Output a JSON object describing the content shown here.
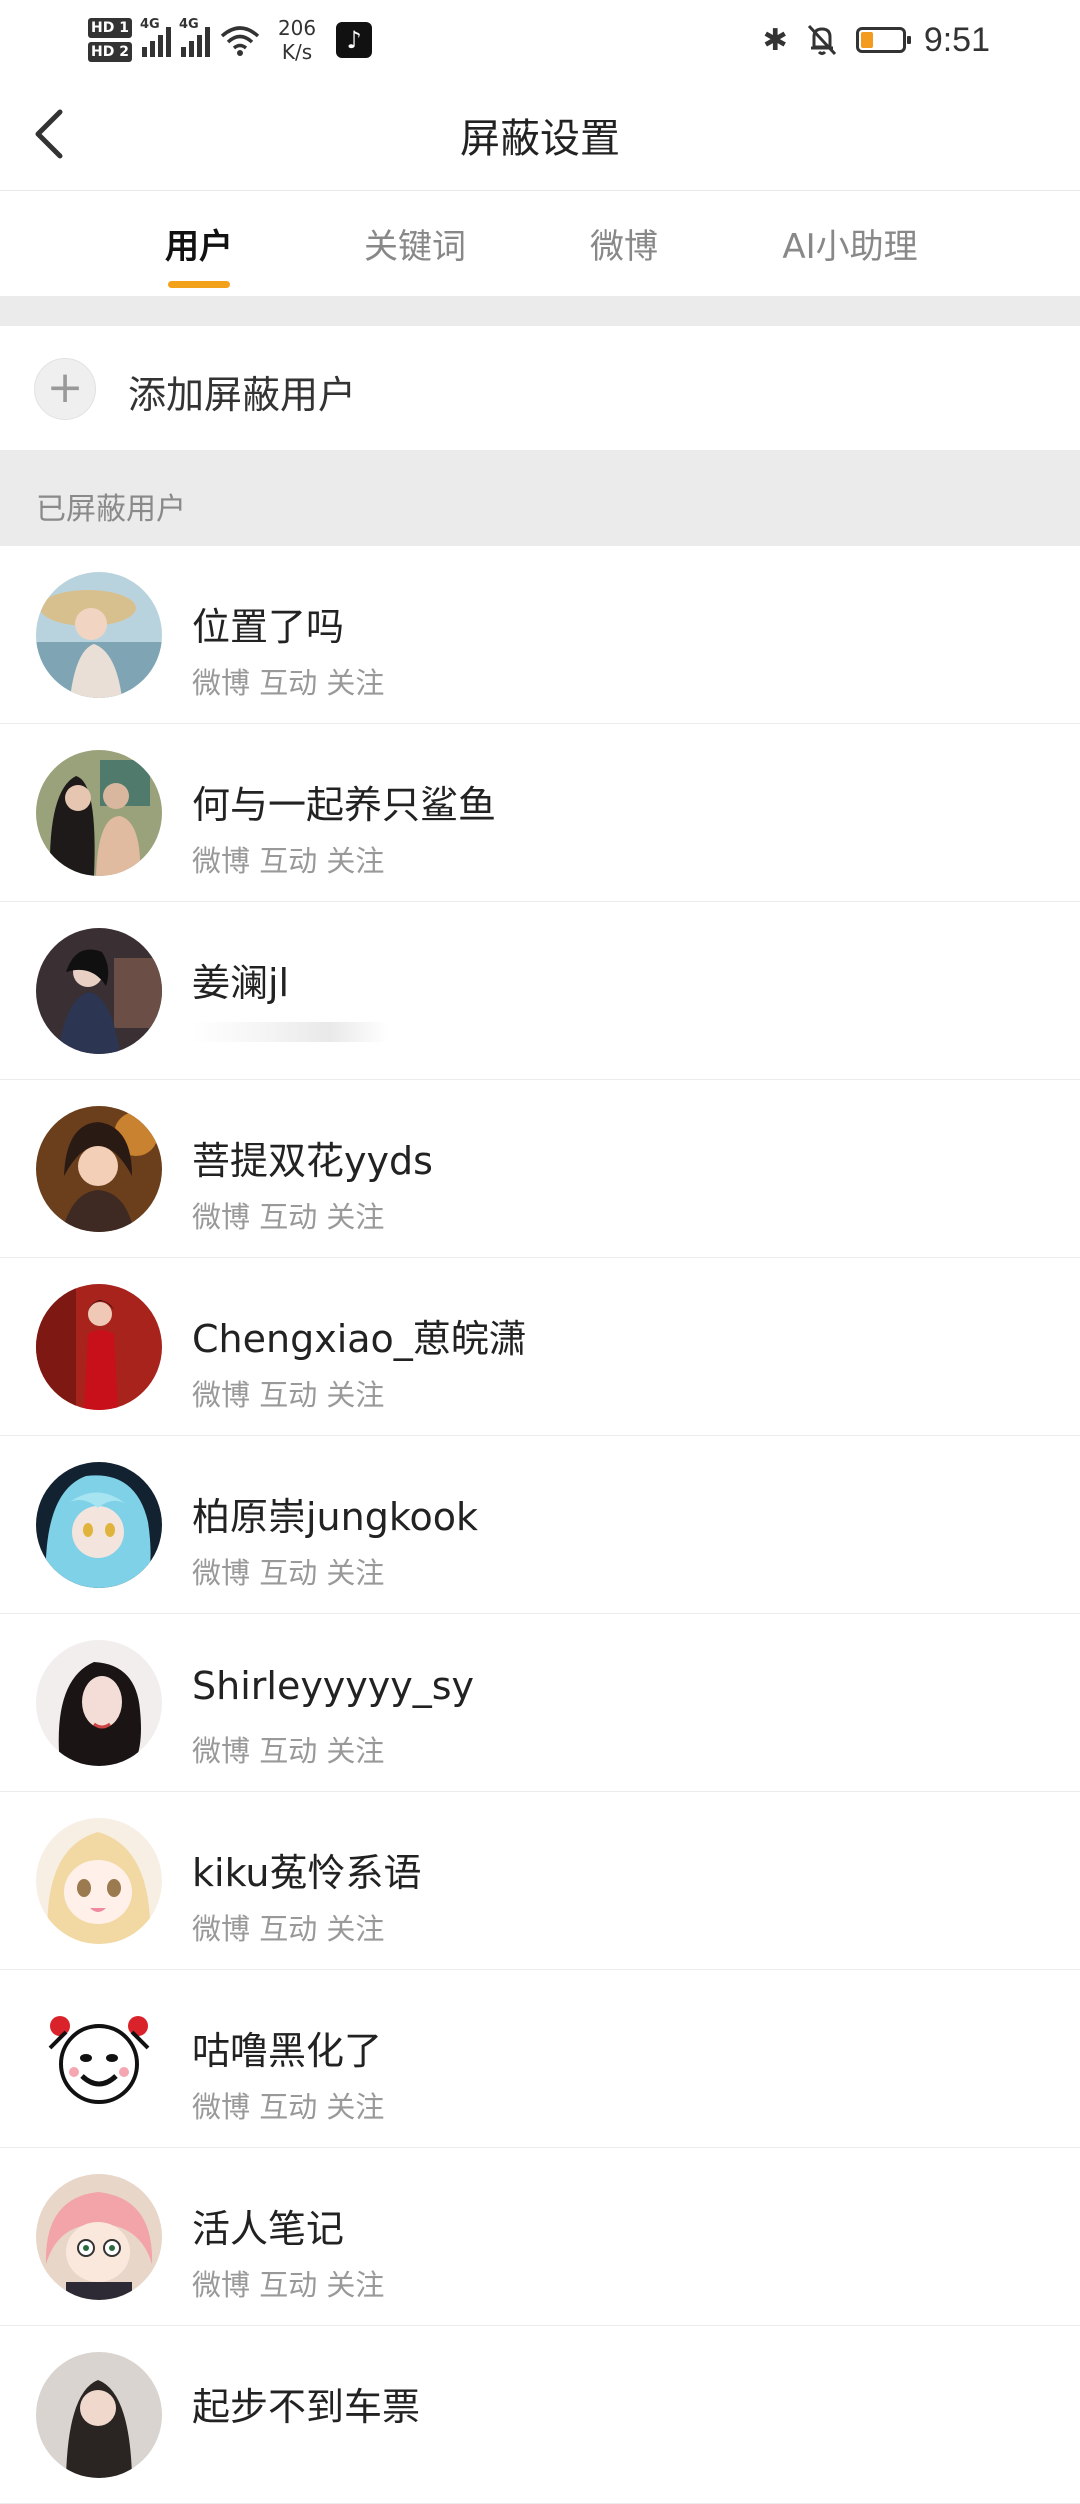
{
  "status_bar": {
    "hd1": "HD 1",
    "hd2": "HD 2",
    "net1": "4G",
    "net2": "4G",
    "speed_value": "206",
    "speed_unit": "K/s",
    "app_icon": "tiktok-icon",
    "bluetooth_icon": "bluetooth-icon",
    "mute_icon": "bell-muted-icon",
    "battery_icon": "battery-low-icon",
    "battery_color": "#f39b1f",
    "time": "9:51"
  },
  "header": {
    "back_icon": "chevron-left-icon",
    "title": "屏蔽设置"
  },
  "tabs": [
    {
      "label": "用户",
      "active": true
    },
    {
      "label": "关键词",
      "active": false
    },
    {
      "label": "微博",
      "active": false
    },
    {
      "label": "AI小助理",
      "active": false
    }
  ],
  "accent_color": "#f3a01b",
  "add_row": {
    "icon": "plus-icon",
    "label": "添加屏蔽用户"
  },
  "section_title": "已屏蔽用户",
  "users": [
    {
      "name": "位置了吗",
      "sub": "微博 互动 关注"
    },
    {
      "name": "何与一起养只鲨鱼",
      "sub": "微博 互动 关注"
    },
    {
      "name": "姜澜jl",
      "sub": ""
    },
    {
      "name": "菩提双花yyds",
      "sub": "微博 互动 关注"
    },
    {
      "name": "Chengxiao_葸皖潇",
      "sub": "微博 互动 关注"
    },
    {
      "name": "柏原崇jungkook",
      "sub": "微博 互动 关注"
    },
    {
      "name": "Shirleyyyyy_sy",
      "sub": "微博 互动 关注"
    },
    {
      "name": "kiku菟怜系语",
      "sub": "微博 互动 关注"
    },
    {
      "name": "咕噜黑化了",
      "sub": "微博 互动 关注"
    },
    {
      "name": "活人笔记",
      "sub": "微博 互动 关注"
    },
    {
      "name": "起步不到车票",
      "sub": ""
    }
  ]
}
